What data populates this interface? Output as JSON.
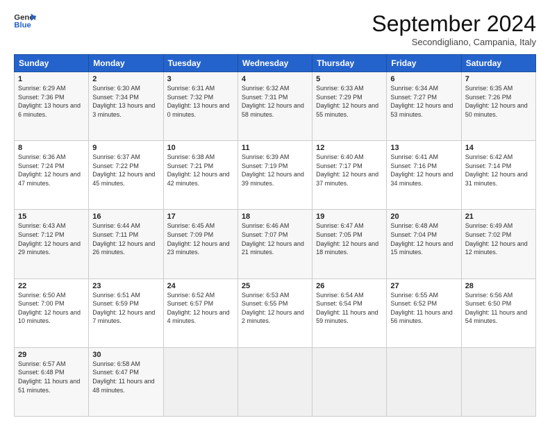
{
  "header": {
    "logo_line1": "General",
    "logo_line2": "Blue",
    "month_title": "September 2024",
    "location": "Secondigliano, Campania, Italy"
  },
  "weekdays": [
    "Sunday",
    "Monday",
    "Tuesday",
    "Wednesday",
    "Thursday",
    "Friday",
    "Saturday"
  ],
  "weeks": [
    [
      {
        "day": "1",
        "sunrise": "6:29 AM",
        "sunset": "7:36 PM",
        "daylight": "13 hours and 6 minutes."
      },
      {
        "day": "2",
        "sunrise": "6:30 AM",
        "sunset": "7:34 PM",
        "daylight": "13 hours and 3 minutes."
      },
      {
        "day": "3",
        "sunrise": "6:31 AM",
        "sunset": "7:32 PM",
        "daylight": "13 hours and 0 minutes."
      },
      {
        "day": "4",
        "sunrise": "6:32 AM",
        "sunset": "7:31 PM",
        "daylight": "12 hours and 58 minutes."
      },
      {
        "day": "5",
        "sunrise": "6:33 AM",
        "sunset": "7:29 PM",
        "daylight": "12 hours and 55 minutes."
      },
      {
        "day": "6",
        "sunrise": "6:34 AM",
        "sunset": "7:27 PM",
        "daylight": "12 hours and 53 minutes."
      },
      {
        "day": "7",
        "sunrise": "6:35 AM",
        "sunset": "7:26 PM",
        "daylight": "12 hours and 50 minutes."
      }
    ],
    [
      {
        "day": "8",
        "sunrise": "6:36 AM",
        "sunset": "7:24 PM",
        "daylight": "12 hours and 47 minutes."
      },
      {
        "day": "9",
        "sunrise": "6:37 AM",
        "sunset": "7:22 PM",
        "daylight": "12 hours and 45 minutes."
      },
      {
        "day": "10",
        "sunrise": "6:38 AM",
        "sunset": "7:21 PM",
        "daylight": "12 hours and 42 minutes."
      },
      {
        "day": "11",
        "sunrise": "6:39 AM",
        "sunset": "7:19 PM",
        "daylight": "12 hours and 39 minutes."
      },
      {
        "day": "12",
        "sunrise": "6:40 AM",
        "sunset": "7:17 PM",
        "daylight": "12 hours and 37 minutes."
      },
      {
        "day": "13",
        "sunrise": "6:41 AM",
        "sunset": "7:16 PM",
        "daylight": "12 hours and 34 minutes."
      },
      {
        "day": "14",
        "sunrise": "6:42 AM",
        "sunset": "7:14 PM",
        "daylight": "12 hours and 31 minutes."
      }
    ],
    [
      {
        "day": "15",
        "sunrise": "6:43 AM",
        "sunset": "7:12 PM",
        "daylight": "12 hours and 29 minutes."
      },
      {
        "day": "16",
        "sunrise": "6:44 AM",
        "sunset": "7:11 PM",
        "daylight": "12 hours and 26 minutes."
      },
      {
        "day": "17",
        "sunrise": "6:45 AM",
        "sunset": "7:09 PM",
        "daylight": "12 hours and 23 minutes."
      },
      {
        "day": "18",
        "sunrise": "6:46 AM",
        "sunset": "7:07 PM",
        "daylight": "12 hours and 21 minutes."
      },
      {
        "day": "19",
        "sunrise": "6:47 AM",
        "sunset": "7:05 PM",
        "daylight": "12 hours and 18 minutes."
      },
      {
        "day": "20",
        "sunrise": "6:48 AM",
        "sunset": "7:04 PM",
        "daylight": "12 hours and 15 minutes."
      },
      {
        "day": "21",
        "sunrise": "6:49 AM",
        "sunset": "7:02 PM",
        "daylight": "12 hours and 12 minutes."
      }
    ],
    [
      {
        "day": "22",
        "sunrise": "6:50 AM",
        "sunset": "7:00 PM",
        "daylight": "12 hours and 10 minutes."
      },
      {
        "day": "23",
        "sunrise": "6:51 AM",
        "sunset": "6:59 PM",
        "daylight": "12 hours and 7 minutes."
      },
      {
        "day": "24",
        "sunrise": "6:52 AM",
        "sunset": "6:57 PM",
        "daylight": "12 hours and 4 minutes."
      },
      {
        "day": "25",
        "sunrise": "6:53 AM",
        "sunset": "6:55 PM",
        "daylight": "12 hours and 2 minutes."
      },
      {
        "day": "26",
        "sunrise": "6:54 AM",
        "sunset": "6:54 PM",
        "daylight": "11 hours and 59 minutes."
      },
      {
        "day": "27",
        "sunrise": "6:55 AM",
        "sunset": "6:52 PM",
        "daylight": "11 hours and 56 minutes."
      },
      {
        "day": "28",
        "sunrise": "6:56 AM",
        "sunset": "6:50 PM",
        "daylight": "11 hours and 54 minutes."
      }
    ],
    [
      {
        "day": "29",
        "sunrise": "6:57 AM",
        "sunset": "6:48 PM",
        "daylight": "11 hours and 51 minutes."
      },
      {
        "day": "30",
        "sunrise": "6:58 AM",
        "sunset": "6:47 PM",
        "daylight": "11 hours and 48 minutes."
      },
      null,
      null,
      null,
      null,
      null
    ]
  ]
}
